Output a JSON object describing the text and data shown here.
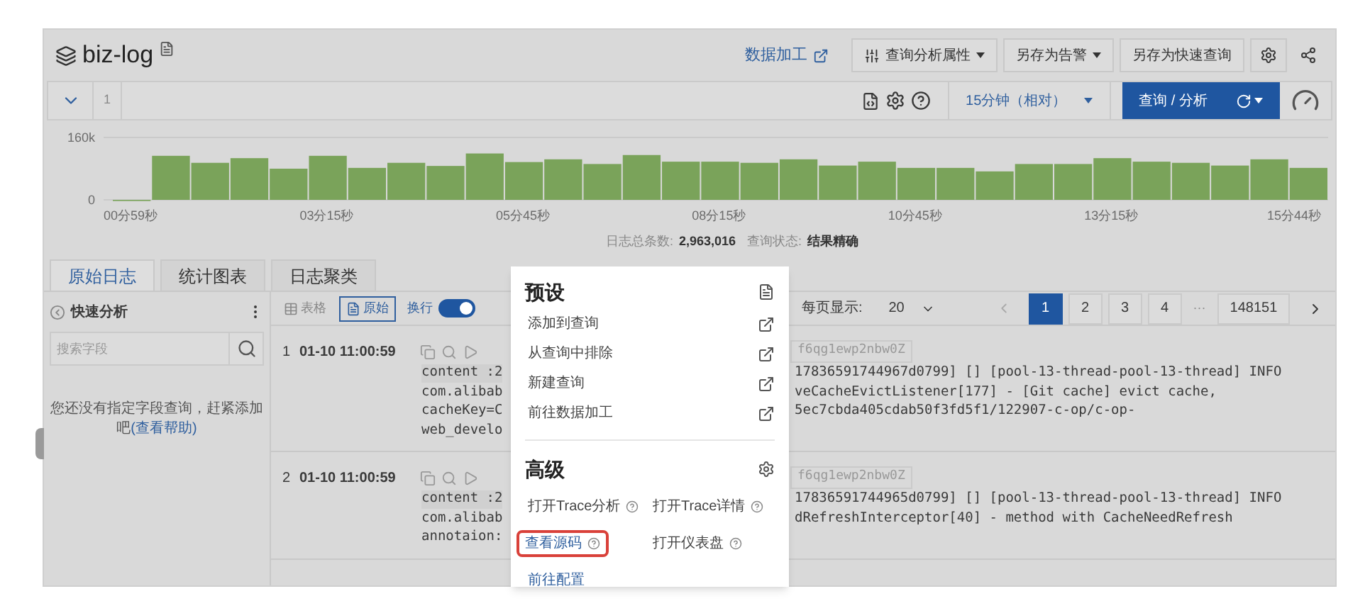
{
  "header": {
    "title": "biz-log",
    "link": "数据加工",
    "toolbar": [
      {
        "label": "查询分析属性",
        "kind": "dropdown-icon"
      },
      {
        "label": "另存为告警",
        "kind": "dropdown"
      },
      {
        "label": "另存为快速查询",
        "kind": "plain"
      }
    ]
  },
  "query": {
    "line_number": "1",
    "time_range": "15分钟（相对）",
    "submit": "查询 / 分析"
  },
  "histogram": {
    "chart_data": {
      "type": "bar",
      "categories": [
        "00分59秒",
        null,
        null,
        null,
        null,
        "03分15秒",
        null,
        null,
        null,
        null,
        "05分45秒",
        null,
        null,
        null,
        null,
        "08分15秒",
        null,
        null,
        null,
        null,
        "10分45秒",
        null,
        null,
        null,
        null,
        "13分15秒",
        null,
        null,
        null,
        null,
        "15分44秒"
      ],
      "values": [
        0,
        113000,
        95000,
        107000,
        80000,
        113000,
        82000,
        95000,
        87000,
        119000,
        97000,
        104000,
        92000,
        115000,
        98000,
        98000,
        95000,
        104000,
        88000,
        98000,
        82000,
        82000,
        73000,
        92000,
        92000,
        107000,
        98000,
        95000,
        88000,
        104000,
        82000
      ],
      "ylim": [
        0,
        160000
      ],
      "yticks": [
        0,
        {
          "value": 160000,
          "label": "160k"
        }
      ]
    }
  },
  "summary": [
    {
      "label": "日志总条数:",
      "value": "2,963,016"
    },
    {
      "label": "查询状态:",
      "value": "结果精确"
    }
  ],
  "tabs": [
    {
      "label": "原始日志",
      "selected": true
    },
    {
      "label": "统计图表",
      "selected": false
    },
    {
      "label": "日志聚类",
      "selected": false
    }
  ],
  "quick_analysis": {
    "title": "快速分析",
    "search_placeholder": "搜索字段",
    "message": "您还没有指定字段查询，赶紧添加吧",
    "help_link": "(查看帮助)"
  },
  "view_modes": [
    {
      "label": "表格",
      "kind": "table",
      "selected": false
    },
    {
      "label": "原始",
      "kind": "raw",
      "selected": true
    }
  ],
  "wrap": {
    "label": "换行",
    "on": true
  },
  "page_size": {
    "label": "每页显示:",
    "value": "20"
  },
  "pagination": [
    {
      "label": "1",
      "kind": "page",
      "selected": true
    },
    {
      "label": "2",
      "kind": "page",
      "selected": false
    },
    {
      "label": "3",
      "kind": "page",
      "selected": false
    },
    {
      "label": "4",
      "kind": "page",
      "selected": false
    },
    {
      "label": "···",
      "kind": "ellipsis",
      "selected": false
    },
    {
      "label": "148151",
      "kind": "page",
      "selected": false
    }
  ],
  "logs": [
    {
      "index": "1",
      "time": "01-10 11:00:59",
      "tag": "f6qg1ewp2nbw0Z",
      "lines": [
        {
          "left": "content :2",
          "right": "17836591744967d0799] [] [pool-13-thread-pool-13-thread] INFO"
        },
        {
          "left": "com.alibab",
          "right": "veCacheEvictListener[177] - [Git cache] evict cache,"
        },
        {
          "left": "cacheKey=C",
          "right": "5ec7cbda405cdab50f3fd5f1/122907-c-op/c-op-"
        },
        {
          "left": "web_develo"
        }
      ]
    },
    {
      "index": "2",
      "time": "01-10 11:00:59",
      "tag": "f6qg1ewp2nbw0Z",
      "lines": [
        {
          "left": "content :2",
          "right": "17836591744965d0799] [] [pool-13-thread-pool-13-thread] INFO"
        },
        {
          "left": "com.alibab",
          "right": "dRefreshInterceptor[40] - method with CacheNeedRefresh"
        },
        {
          "left": "annotaion:"
        }
      ]
    }
  ],
  "context_menu": {
    "sections": [
      {
        "title": "预设",
        "kind": "preset",
        "items": [
          {
            "label": "添加到查询",
            "kind": "external",
            "highlighted": false
          },
          {
            "label": "从查询中排除",
            "kind": "external",
            "highlighted": false
          },
          {
            "label": "新建查询",
            "kind": "external",
            "highlighted": false
          },
          {
            "label": "前往数据加工",
            "kind": "external",
            "highlighted": false
          }
        ]
      },
      {
        "title": "高级",
        "kind": "advanced",
        "items": [
          {
            "label": "打开Trace分析",
            "kind": "help",
            "highlighted": false
          },
          {
            "label": "打开Trace详情",
            "kind": "help",
            "highlighted": false
          },
          {
            "label": "查看源码",
            "kind": "help",
            "highlighted": true
          },
          {
            "label": "打开仪表盘",
            "kind": "help",
            "highlighted": false
          },
          {
            "label": "前往配置",
            "kind": "link",
            "highlighted": false
          }
        ]
      }
    ]
  }
}
